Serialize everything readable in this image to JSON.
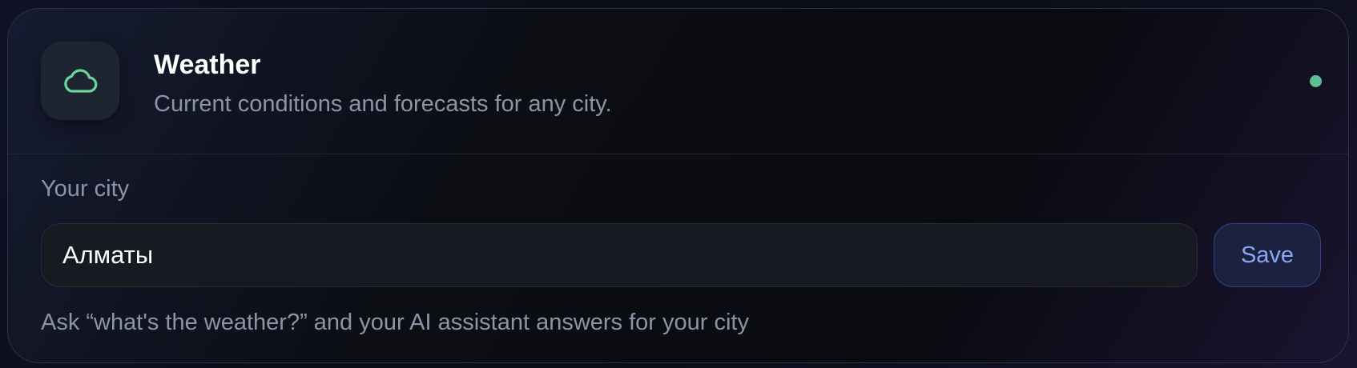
{
  "widget": {
    "icon": "cloud-icon",
    "title": "Weather",
    "subtitle": "Current conditions and forecasts for any city.",
    "status": "online",
    "status_color": "#5ec08f",
    "accent_color": "#6fd3a0"
  },
  "city_form": {
    "label": "Your city",
    "value": "Алматы",
    "save_label": "Save",
    "hint": "Ask “what's the weather?” and your AI assistant answers for your city"
  }
}
